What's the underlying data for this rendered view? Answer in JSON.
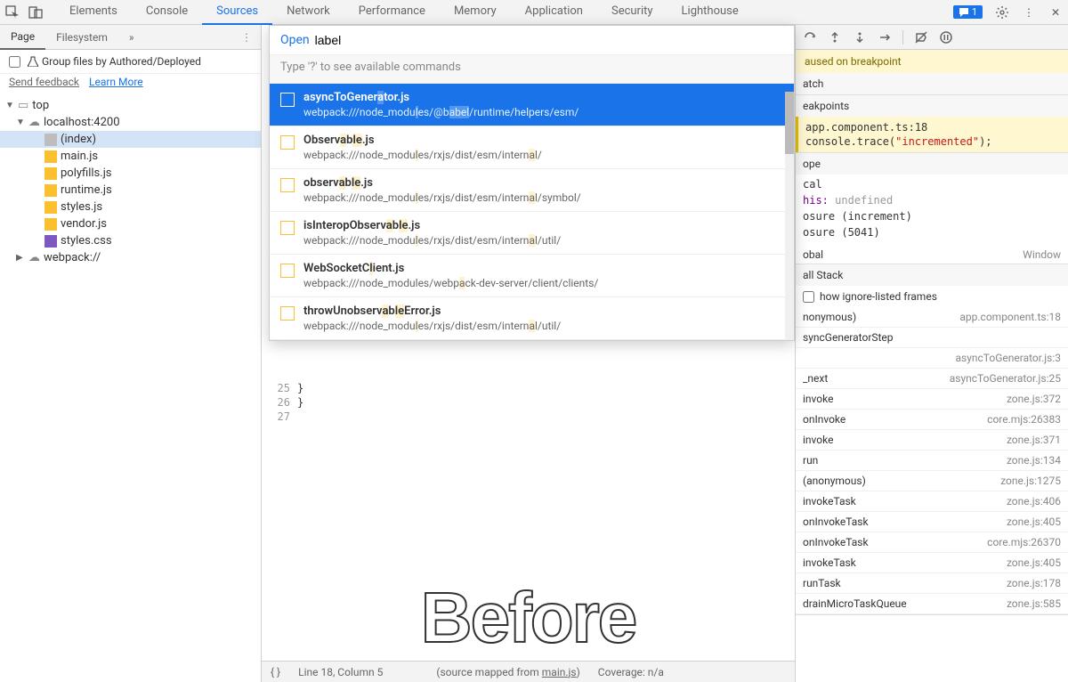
{
  "toolbar": {
    "tabs": [
      "Elements",
      "Console",
      "Sources",
      "Network",
      "Performance",
      "Memory",
      "Application",
      "Security",
      "Lighthouse"
    ],
    "active_tab": "Sources",
    "feedback_count": "1"
  },
  "left": {
    "tabs": [
      "Page",
      "Filesystem"
    ],
    "active_tab": "Page",
    "group_label": "Group files by Authored/Deployed",
    "send_feedback": "Send feedback",
    "learn_more": "Learn More",
    "tree": {
      "top": "top",
      "host": "localhost:4200",
      "files": [
        "(index)",
        "main.js",
        "polyfills.js",
        "runtime.js",
        "styles.js",
        "vendor.js",
        "styles.css"
      ],
      "webpack": "webpack://"
    }
  },
  "quickopen": {
    "open_label": "Open",
    "query": "label",
    "hint": "Type '?' to see available commands",
    "results": [
      {
        "name": "asyncToGenerator.js",
        "path": "webpack:///node_modules/@babel/runtime/helpers/esm/"
      },
      {
        "name": "Observable.js",
        "path": "webpack:///node_modules/rxjs/dist/esm/internal/"
      },
      {
        "name": "observable.js",
        "path": "webpack:///node_modules/rxjs/dist/esm/internal/symbol/"
      },
      {
        "name": "isInteropObservable.js",
        "path": "webpack:///node_modules/rxjs/dist/esm/internal/util/"
      },
      {
        "name": "WebSocketClient.js",
        "path": "webpack:///node_modules/webpack-dev-server/client/clients/"
      },
      {
        "name": "throwUnobservableError.js",
        "path": "webpack:///node_modules/rxjs/dist/esm/internal/util/"
      }
    ]
  },
  "code": {
    "gutter": [
      "25",
      "26",
      "27"
    ],
    "lines": [
      "  }",
      "}",
      ""
    ]
  },
  "overlay_text": "Before",
  "statusbar": {
    "pos": "Line 18, Column 5",
    "mapped": "(source mapped from ",
    "mapped_file": "main.js",
    "mapped_close": ")",
    "coverage": "Coverage: n/a"
  },
  "debugger": {
    "paused": "aused on breakpoint",
    "watch": "atch",
    "breakpoints": "eakpoints",
    "bp_line1": "app.component.ts:18",
    "bp_line2_a": "console.trace(",
    "bp_line2_b": "\"incremented\"",
    "bp_line2_c": ");",
    "scope": "ope",
    "local": "cal",
    "this_label": "his:",
    "this_val": "undefined",
    "closure1": "osure (increment)",
    "closure2": "osure (5041)",
    "global": "obal",
    "window": "Window",
    "callstack": "all Stack",
    "ignore": "how ignore-listed frames",
    "stack": [
      {
        "fn": "nonymous)",
        "loc": "app.component.ts:18"
      },
      {
        "fn": "syncGeneratorStep",
        "loc": ""
      },
      {
        "fn": "",
        "loc": "asyncToGenerator.js:3"
      },
      {
        "fn": "_next",
        "loc": "asyncToGenerator.js:25"
      },
      {
        "fn": "invoke",
        "loc": "zone.js:372"
      },
      {
        "fn": "onInvoke",
        "loc": "core.mjs:26383"
      },
      {
        "fn": "invoke",
        "loc": "zone.js:371"
      },
      {
        "fn": "run",
        "loc": "zone.js:134"
      },
      {
        "fn": "(anonymous)",
        "loc": "zone.js:1275"
      },
      {
        "fn": "invokeTask",
        "loc": "zone.js:406"
      },
      {
        "fn": "onInvokeTask",
        "loc": "zone.js:405"
      },
      {
        "fn": "onInvokeTask",
        "loc": "core.mjs:26370"
      },
      {
        "fn": "invokeTask",
        "loc": "zone.js:405"
      },
      {
        "fn": "runTask",
        "loc": "zone.js:178"
      },
      {
        "fn": "drainMicroTaskQueue",
        "loc": "zone.js:585"
      }
    ]
  }
}
